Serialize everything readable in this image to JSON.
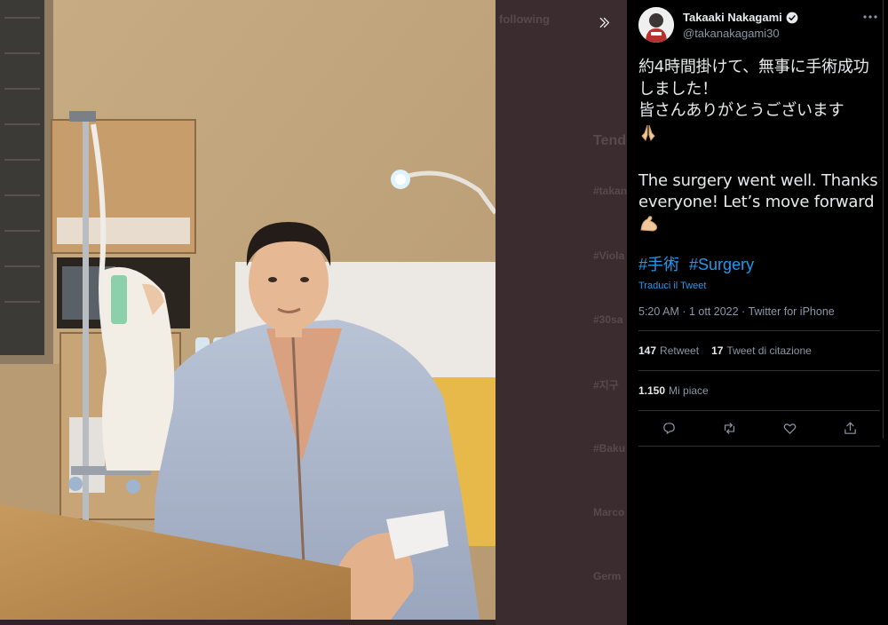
{
  "tweet": {
    "author_name": "Takaaki Nakagami",
    "handle": "@takanakagami30",
    "text": "約4時間掛けて、無事に手術成功しました！\n皆さんありがとうございます",
    "text_en": "The surgery went well. Thanks everyone! Let’s move forward",
    "hashtags": [
      "#手術",
      "#Surgery"
    ],
    "translate_label": "Traduci il Tweet",
    "meta": "5:20 AM · 1 ott 2022 · Twitter for iPhone",
    "retweets": {
      "count": "147",
      "label": "Retweet"
    },
    "quotes": {
      "count": "17",
      "label": "Tweet di citazione"
    },
    "likes": {
      "count": "1.150",
      "label": "Mi piace"
    }
  },
  "icons": {
    "verified": "verified-badge-icon",
    "more": "more-dots-icon",
    "expand": "double-chevron-right-icon",
    "reply": "reply-icon",
    "retweet": "retweet-icon",
    "like": "heart-icon",
    "share": "share-icon",
    "pray_emoji": "folded-hands-emoji",
    "muscle_emoji": "flexed-biceps-emoji"
  },
  "background_timeline": [
    "following",
    "Tende",
    "#takan",
    "#Viola",
    "#30sa",
    "#지구",
    "#Baku",
    "Marco",
    "Germ"
  ],
  "colors": {
    "accent": "#1d9bf0",
    "panel_bg": "#000000",
    "muted": "#8b98a5"
  }
}
